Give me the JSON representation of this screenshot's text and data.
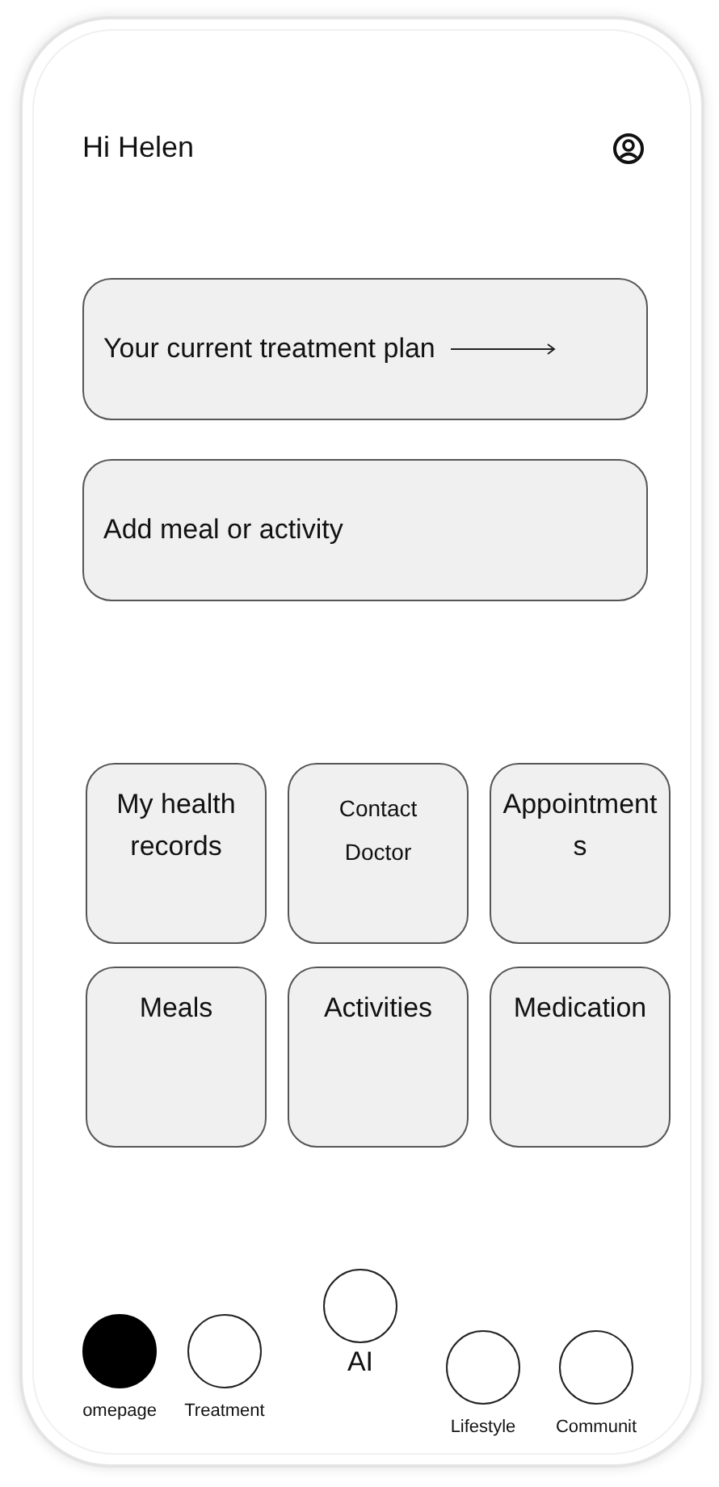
{
  "header": {
    "greeting": "Hi Helen"
  },
  "cards": [
    {
      "label": "Your current treatment plan",
      "arrow": true
    },
    {
      "label": "Add meal or activity",
      "arrow": false
    }
  ],
  "tiles": [
    {
      "label": "My health records",
      "small": false
    },
    {
      "label": "Contact Doctor",
      "small": true
    },
    {
      "label": "Appointments",
      "small": false
    },
    {
      "label": "Meals",
      "small": false
    },
    {
      "label": "Activities",
      "small": false
    },
    {
      "label": "Medication",
      "small": false
    }
  ],
  "nav": [
    {
      "label": "omepage",
      "selected": true
    },
    {
      "label": "Treatment",
      "selected": false
    },
    {
      "label": "AI",
      "selected": false
    },
    {
      "label": "Lifestyle",
      "selected": false
    },
    {
      "label": "Communit",
      "selected": false
    }
  ]
}
